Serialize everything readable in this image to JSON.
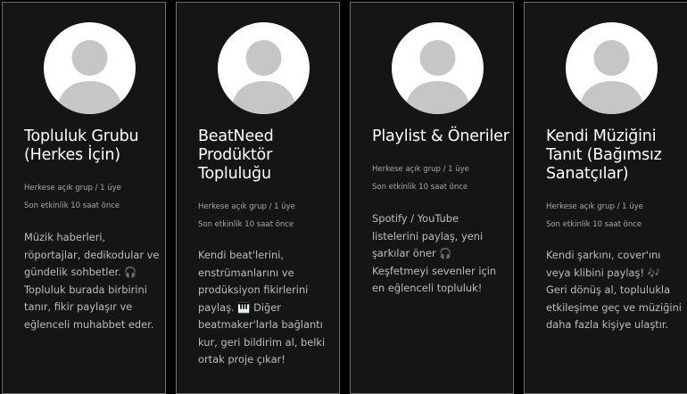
{
  "groups": [
    {
      "title": "Topluluk Grubu (Herkes İçin)",
      "privacy": "Herkese açık grup / 1 üye",
      "activity": "Son etkinlik 10 saat önce",
      "description": "Müzik haberleri, röportajlar, dedikodular ve gündelik sohbetler. 🎧 Topluluk burada birbirini tanır, fikir paylaşır ve eğlenceli muhabbet eder."
    },
    {
      "title": "BeatNeed Prodüktör Topluluğu",
      "privacy": "Herkese açık grup / 1 üye",
      "activity": "Son etkinlik 10 saat önce",
      "description": "Kendi beat'lerini, enstrümanlarını ve prodüksiyon fikirlerini paylaş. 🎹 Diğer beatmaker'larla bağlantı kur, geri bildirim al, belki ortak proje çıkar!"
    },
    {
      "title": "Playlist & Öneriler",
      "privacy": "Herkese açık grup / 1 üye",
      "activity": "Son etkinlik 10 saat önce",
      "description": "Spotify / YouTube listelerini paylaş, yeni şarkılar öner 🎧 Keşfetmeyi sevenler için en eğlenceli topluluk!"
    },
    {
      "title": "Kendi Müziğini Tanıt (Bağımsız Sanatçılar)",
      "privacy": "Herkese açık grup / 1 üye",
      "activity": "Son etkinlik 10 saat önce",
      "description": "Kendi şarkını, cover'ını veya klibini paylaş! 🎶 Geri dönüş al, toplulukla etkileşime geç ve müziğini daha fazla kişiye ulaştır."
    }
  ],
  "colors": {
    "background": "#000000",
    "card": "#151515",
    "card_border": "#6e6e6e",
    "title": "#ffffff",
    "meta": "#a8a8a8",
    "description": "#bdbdbd",
    "avatar_bg": "#ffffff",
    "avatar_figure": "#c6c6c6"
  },
  "icons": {
    "avatar": "default-user-avatar-icon"
  }
}
